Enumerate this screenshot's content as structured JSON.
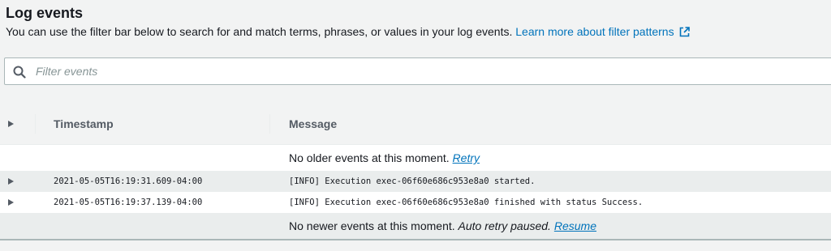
{
  "header": {
    "title": "Log events",
    "description": "You can use the filter bar below to search for and match terms, phrases, or values in your log events.",
    "learn_more_link": "Learn more about filter patterns"
  },
  "search": {
    "placeholder": "Filter events",
    "value": ""
  },
  "table": {
    "columns": [
      "Timestamp",
      "Message"
    ],
    "older_notice": "No older events at this moment.",
    "older_retry": "Retry",
    "rows": [
      {
        "timestamp": "2021-05-05T16:19:31.609-04:00",
        "message": "[INFO] Execution exec-06f60e686c953e8a0 started."
      },
      {
        "timestamp": "2021-05-05T16:19:37.139-04:00",
        "message": "[INFO] Execution exec-06f60e686c953e8a0 finished with status Success."
      }
    ],
    "newer_notice": "No newer events at this moment.",
    "newer_paused": "Auto retry paused.",
    "newer_resume": "Resume"
  },
  "colors": {
    "link": "#0073bb",
    "background": "#f2f3f3",
    "text": "#16191f"
  },
  "icons": {
    "external": "external-link-icon",
    "search": "search-icon",
    "expand": "caret-right-icon"
  }
}
